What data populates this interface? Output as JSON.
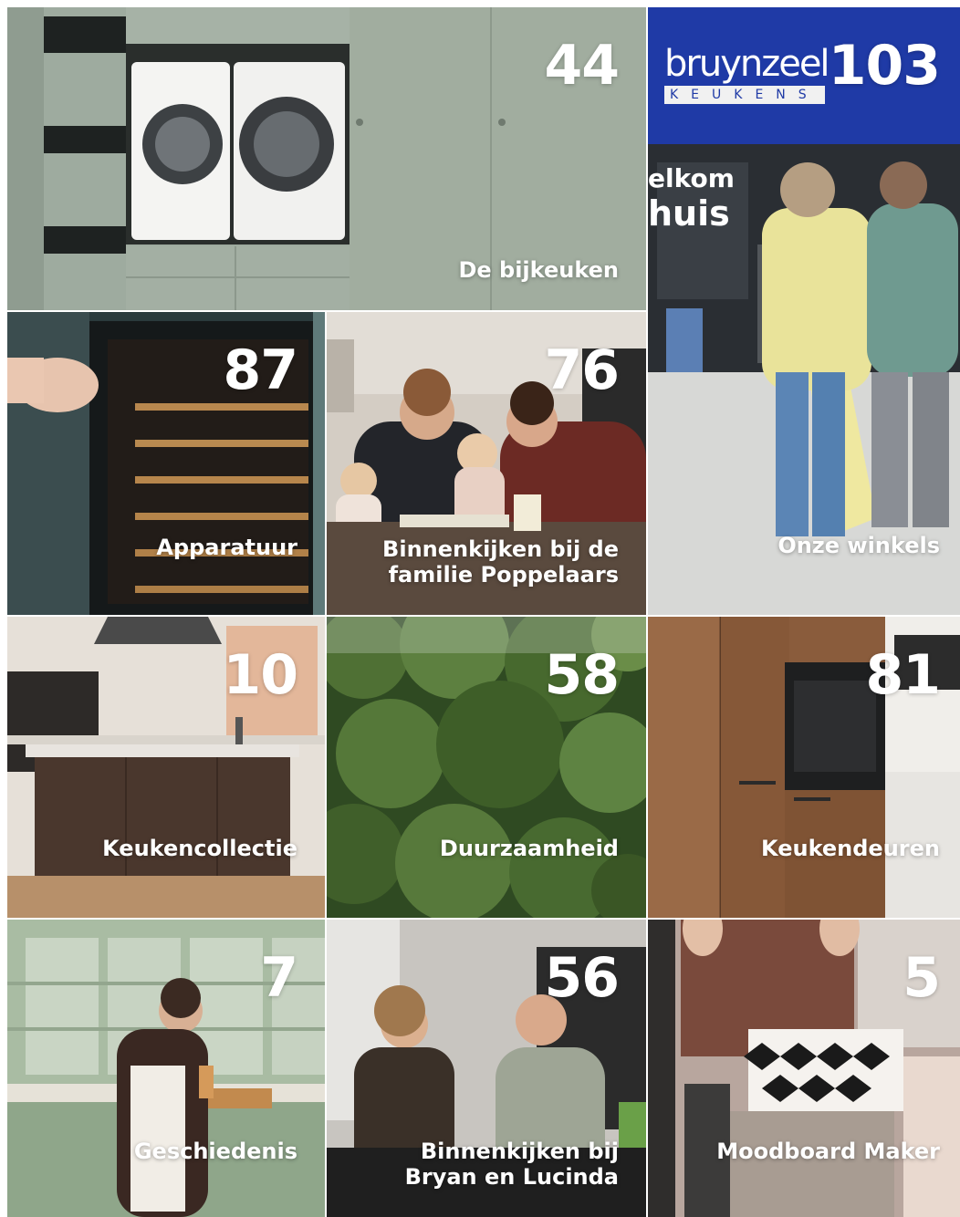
{
  "tiles": [
    {
      "id": "bijkeuken",
      "number": "44",
      "label": "De bijkeuken"
    },
    {
      "id": "winkels",
      "number": "103",
      "label": "Onze winkels",
      "sign_brand": "bruynzeel",
      "sign_sub": "KEUKENS",
      "store_text_1": "elkom",
      "store_text_2": "huis"
    },
    {
      "id": "apparatuur",
      "number": "87",
      "label": "Apparatuur"
    },
    {
      "id": "poppelaars",
      "number": "76",
      "label": "Binnenkijken bij de\nfamilie Poppelaars"
    },
    {
      "id": "collectie",
      "number": "10",
      "label": "Keukencollectie"
    },
    {
      "id": "duurzaam",
      "number": "58",
      "label": "Duurzaamheid"
    },
    {
      "id": "deuren",
      "number": "81",
      "label": "Keukendeuren"
    },
    {
      "id": "geschiedenis",
      "number": "7",
      "label": "Geschiedenis"
    },
    {
      "id": "bryan",
      "number": "56",
      "label": "Binnenkijken bij\nBryan en Lucinda"
    },
    {
      "id": "moodboard",
      "number": "5",
      "label": "Moodboard Maker"
    }
  ],
  "colors": {
    "text": "#ffffff",
    "sign_blue": "#1f3aa6"
  }
}
